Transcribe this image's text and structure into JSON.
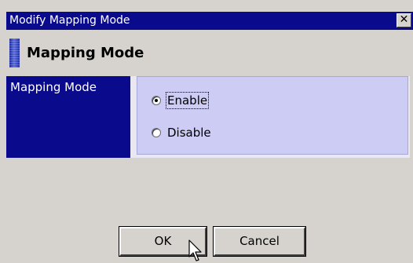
{
  "dialog": {
    "title": "Modify Mapping Mode",
    "close_glyph": "✕"
  },
  "header": {
    "title": "Mapping Mode"
  },
  "field": {
    "label": "Mapping Mode",
    "options": [
      {
        "label": "Enable",
        "checked": true
      },
      {
        "label": "Disable",
        "checked": false
      }
    ]
  },
  "buttons": {
    "ok_label": "OK",
    "cancel_label": "Cancel"
  },
  "colors": {
    "titlebar": "#0a0a8c",
    "options_bg": "#ccccf4",
    "dialog_bg": "#d6d3ce"
  }
}
